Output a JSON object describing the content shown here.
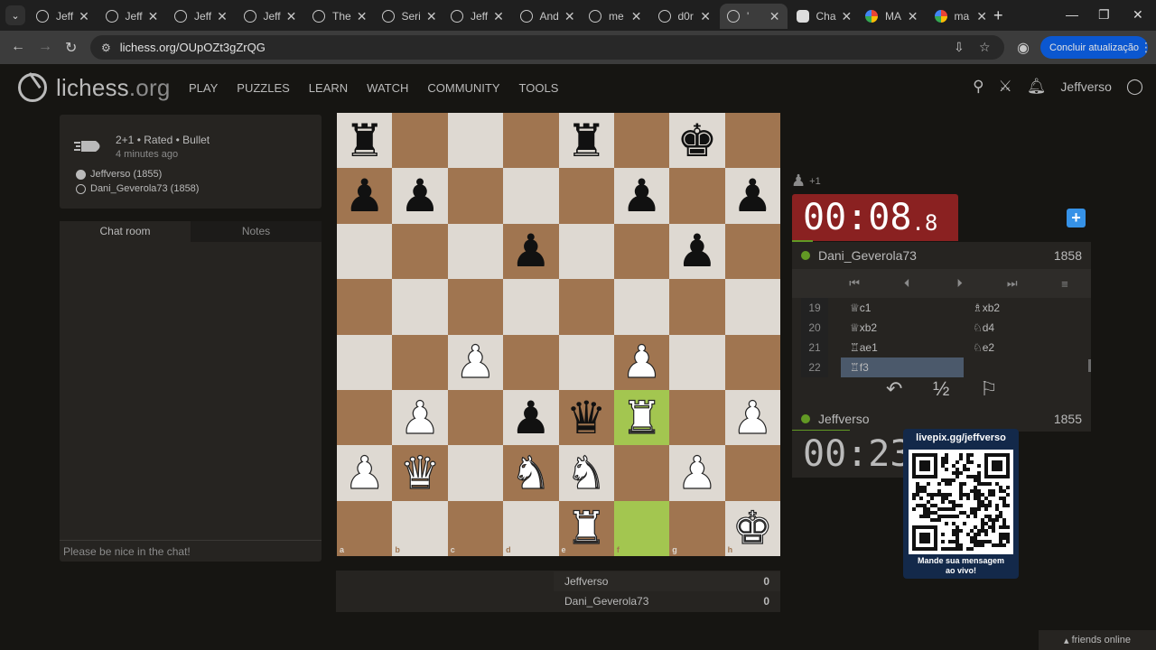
{
  "browser": {
    "tabs": [
      {
        "label": "Jeff"
      },
      {
        "label": "Jeff"
      },
      {
        "label": "Jeff"
      },
      {
        "label": "Jeff"
      },
      {
        "label": "The"
      },
      {
        "label": "Seri"
      },
      {
        "label": "Jeff"
      },
      {
        "label": "And"
      },
      {
        "label": "me"
      },
      {
        "label": "d0r"
      },
      {
        "label": "'"
      },
      {
        "label": "Cha"
      },
      {
        "label": "MA"
      },
      {
        "label": "ma"
      }
    ],
    "url": "lichess.org/OUpOZt3gZrQG",
    "update_label": "Concluir atualização"
  },
  "site": {
    "logo_main": "lichess",
    "logo_suffix": ".org",
    "nav": [
      "PLAY",
      "PUZZLES",
      "LEARN",
      "WATCH",
      "COMMUNITY",
      "TOOLS"
    ],
    "username": "Jeffverso"
  },
  "game": {
    "type": "2+1 • Rated • Bullet",
    "time_ago": "4 minutes ago",
    "white_player": "Jeffverso (1855)",
    "black_player": "Dani_Geverola73 (1858)"
  },
  "chat": {
    "tab_chat": "Chat room",
    "tab_notes": "Notes",
    "placeholder": "Please be nice in the chat!"
  },
  "board": {
    "files": [
      "a",
      "b",
      "c",
      "d",
      "e",
      "f",
      "g",
      "h"
    ],
    "ranks": [
      "8",
      "7",
      "6",
      "5",
      "4",
      "3",
      "2",
      "1"
    ],
    "position": [
      "r...r.k.",
      "pp...p.p",
      "...p..p.",
      "........",
      "..P..P..",
      ".P.pqR.P",
      "PQ.NN.P.",
      "....R..K"
    ],
    "highlight": [
      "f3",
      "f1"
    ]
  },
  "material_diff": "+1",
  "opponent": {
    "name": "Dani_Geverola73",
    "rating": "1858",
    "clock_main": "00:08",
    "clock_frac": ".8"
  },
  "player": {
    "name": "Jeffverso",
    "rating": "1855",
    "clock_main": "00:23"
  },
  "moves": [
    {
      "no": "19",
      "white": "♕c1",
      "black": "♗xb2"
    },
    {
      "no": "20",
      "white": "♕xb2",
      "black": "♘d4"
    },
    {
      "no": "21",
      "white": "♖ae1",
      "black": "♘e2"
    },
    {
      "no": "22",
      "white": "♖f3",
      "black": ""
    }
  ],
  "controls": {
    "first": "⏮",
    "prev": "⏴",
    "next": "⏵",
    "last": "⏭",
    "menu": "≡"
  },
  "actions": {
    "takeback": "↶",
    "draw": "½",
    "resign": "⚐"
  },
  "overlay": {
    "link": "livepix.gg/jeffverso",
    "message_line1": "Mande sua mensagem",
    "message_line2": "ao vivo!"
  },
  "crosstable": [
    {
      "name": "Jeffverso",
      "score": "0"
    },
    {
      "name": "Dani_Geverola73",
      "score": "0"
    }
  ],
  "friends_label": "friends online",
  "colors": {
    "accent": "#3692e7",
    "online": "#629924",
    "low_clock": "#8a2121",
    "highlight": "#a3c650"
  }
}
